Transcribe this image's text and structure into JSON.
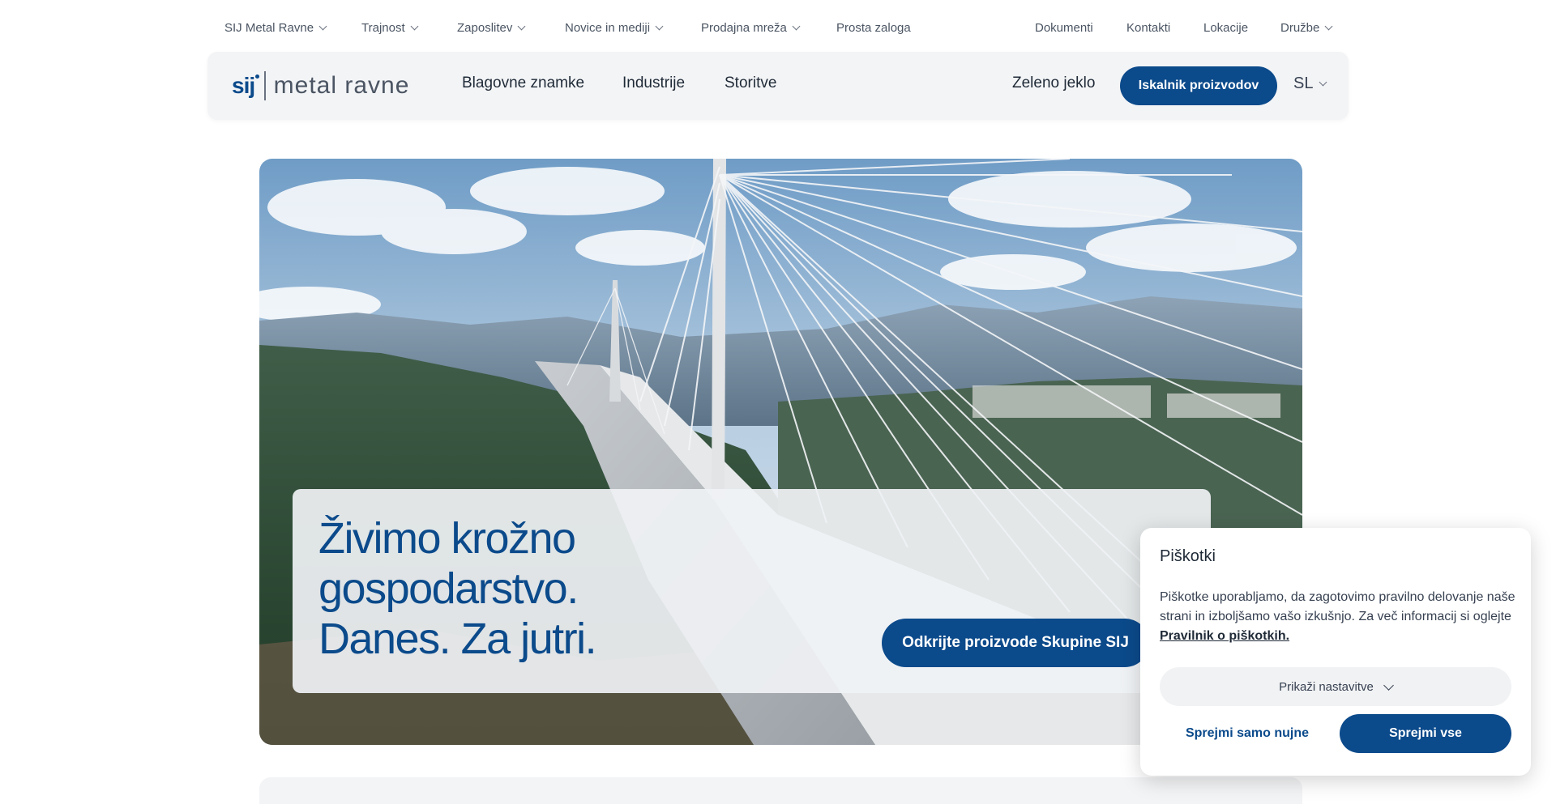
{
  "topnav": {
    "left": [
      {
        "label": "SIJ Metal Ravne",
        "dropdown": true
      },
      {
        "label": "Trajnost",
        "dropdown": true
      },
      {
        "label": "Zaposlitev",
        "dropdown": true
      },
      {
        "label": "Novice in mediji",
        "dropdown": true
      },
      {
        "label": "Prodajna mreža",
        "dropdown": true
      },
      {
        "label": "Prosta zaloga",
        "dropdown": false
      }
    ],
    "right": [
      {
        "label": "Dokumenti",
        "dropdown": false
      },
      {
        "label": "Kontakti",
        "dropdown": false
      },
      {
        "label": "Lokacije",
        "dropdown": false
      },
      {
        "label": "Družbe",
        "dropdown": true
      }
    ]
  },
  "mainnav": {
    "logo_mark": "sij",
    "logo_text": "metal ravne",
    "links": [
      "Blagovne znamke",
      "Industrije",
      "Storitve"
    ],
    "green_steel": "Zeleno jeklo",
    "product_finder": "Iskalnik proizvodov",
    "language": "SL"
  },
  "hero": {
    "title_lines": [
      "Živimo krožno",
      "gospodarstvo.",
      "Danes. Za jutri."
    ],
    "cta": "Odkrijte proizvode Skupine SIJ"
  },
  "cookie": {
    "title": "Piškotki",
    "text": "Piškotke uporabljamo, da zagotovimo pravilno delovanje naše strani in izboljšamo vašo izkušnjo. Za več informacij si oglejte",
    "link": "Pravilnik o piškotkih.",
    "show_settings": "Prikaži nastavitve",
    "accept_necessary": "Sprejmi samo nujne",
    "accept_all": "Sprejmi vse"
  },
  "colors": {
    "brand": "#0b4a8b",
    "nav_bg": "#f3f4f6",
    "text": "#1f2a37"
  }
}
